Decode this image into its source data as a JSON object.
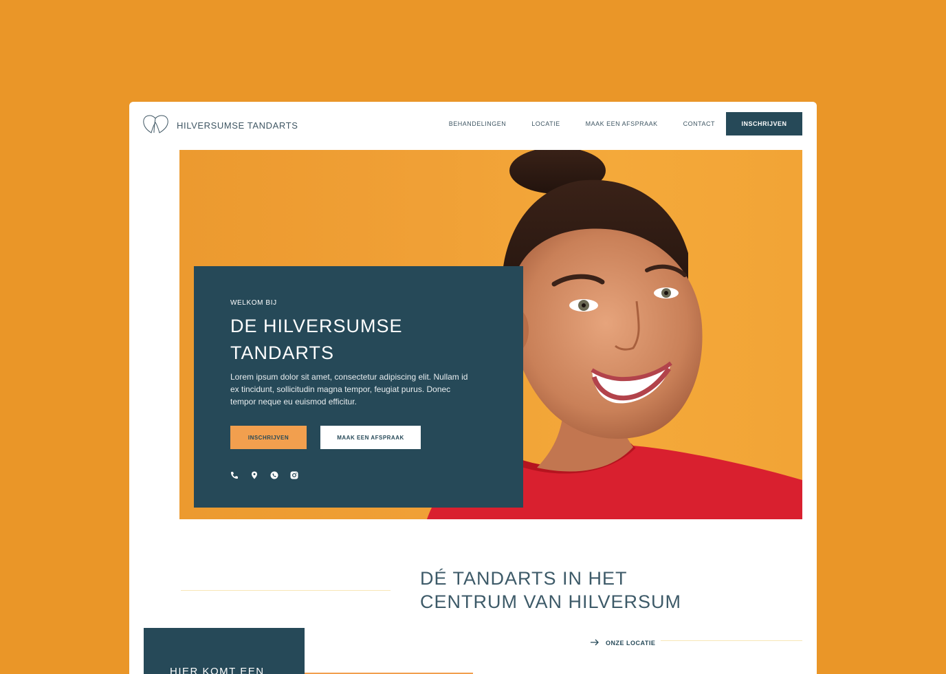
{
  "brand": {
    "name": "HILVERSUMSE TANDARTS",
    "logo_icon": "tooth-outline-icon"
  },
  "nav": {
    "items": [
      "BEHANDELINGEN",
      "LOCATIE",
      "MAAK EEN AFSPRAAK",
      "CONTACT"
    ],
    "cta_label": "INSCHRIJVEN"
  },
  "hero": {
    "eyebrow": "WELKOM BIJ",
    "title": "DE HILVERSUMSE TANDARTS",
    "text": "Lorem ipsum dolor sit amet, consectetur adipiscing elit. Nullam id ex tincidunt, sollicitudin magna tempor, feugiat purus. Donec tempor neque eu euismod efficitur.",
    "primary_label": "INSCHRIJVEN",
    "secondary_label": "MAAK EEN AFSPRAAK",
    "social_icons": [
      "phone-icon",
      "location-pin-icon",
      "whatsapp-icon",
      "instagram-icon"
    ],
    "image": "smiling-woman-photo"
  },
  "section": {
    "title": "DÉ TANDARTS IN HET CENTRUM VAN HILVERSUM",
    "link_label": "ONZE LOCATIE"
  },
  "promo": {
    "text": "HIER KOMT EEN"
  },
  "colors": {
    "page_background": "#EA9628",
    "primary_dark": "#264958",
    "accent": "#F29F4E",
    "hero_orange": "#F0A036",
    "divider": "#F8E6B5"
  }
}
